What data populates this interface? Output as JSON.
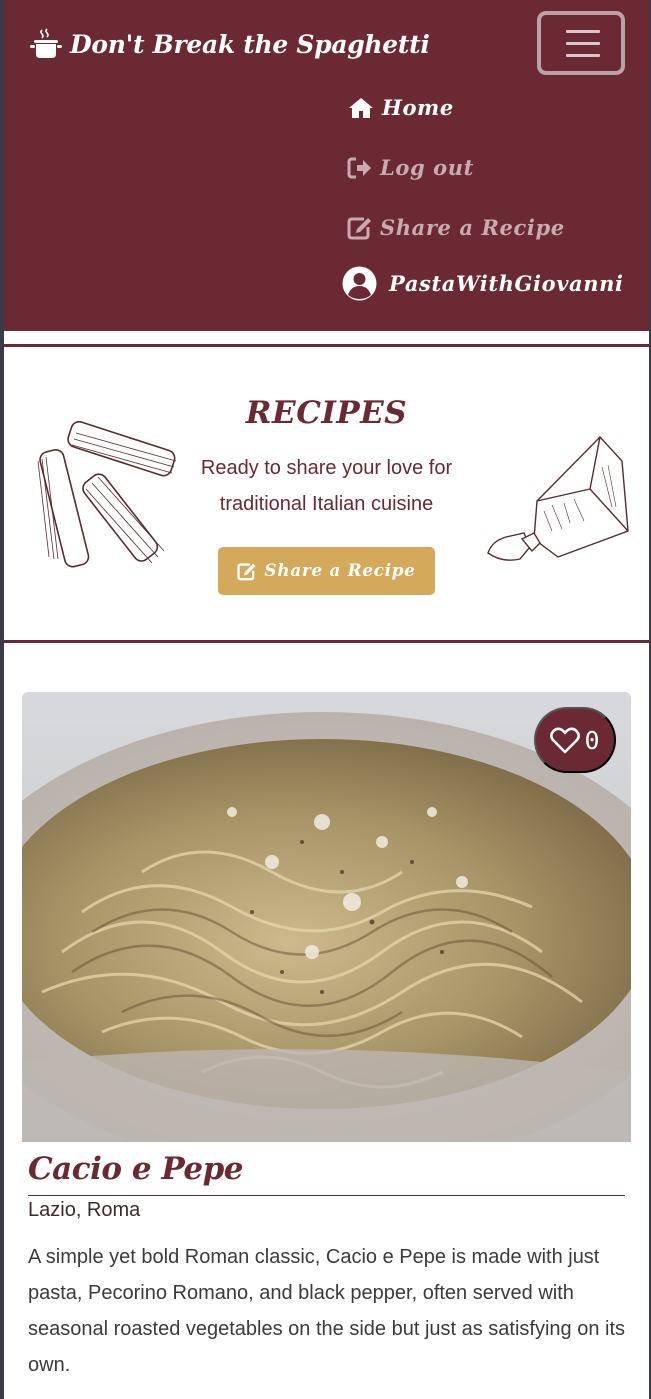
{
  "brand": {
    "name": "Don't Break the Spaghetti",
    "icon": "cooking-pot-icon"
  },
  "nav": {
    "toggler_icon": "hamburger-icon",
    "items": [
      {
        "label": "Home",
        "icon": "house-icon",
        "active": true
      },
      {
        "label": "Log out",
        "icon": "sign-out-icon",
        "active": false
      },
      {
        "label": "Share a Recipe",
        "icon": "edit-icon",
        "active": false
      }
    ],
    "user": {
      "label": "PastaWithGiovanni",
      "icon": "user-circle-icon"
    }
  },
  "hero": {
    "title": "RECIPES",
    "subtitle": "Ready to share your love for traditional Italian cuisine",
    "button_label": "Share a Recipe",
    "button_icon": "edit-icon"
  },
  "recipes": [
    {
      "title": "Cacio e Pepe",
      "region": "Lazio, Roma",
      "description": "A simple yet bold Roman classic, Cacio e Pepe is made with just pasta, Pecorino Romano, and black pepper, often served with seasonal roasted vegetables on the side but just as satisfying on its own.",
      "likes": "0",
      "like_icon": "heart-icon"
    }
  ],
  "colors": {
    "primary": "#6b2a33",
    "accent": "#d5a95a",
    "nav_muted": "#c8aaaf",
    "background": "#ffffff"
  }
}
